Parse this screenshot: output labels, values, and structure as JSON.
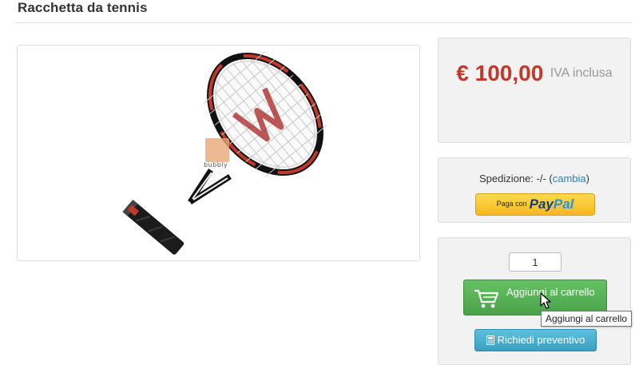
{
  "product": {
    "title": "Racchetta da tennis",
    "watermark": "bubbly"
  },
  "price": {
    "amount": "€ 100,00",
    "vat_note": "IVA inclusa"
  },
  "shipping": {
    "label": "Spedizione: -/- (",
    "change_link": "cambia",
    "close_paren": ")"
  },
  "paypal": {
    "prefix": "Paga con",
    "logo_pay": "Pay",
    "logo_pal": "Pal"
  },
  "cart": {
    "quantity": "1",
    "add_label": "Aggiungi al carrello",
    "quote_label": "Richiedi preventivo",
    "tooltip": "Aggiungi al carrello"
  },
  "colors": {
    "price": "#c0392b",
    "add_button": "#52a94f",
    "quote_button": "#46aed0",
    "link": "#2a80b9"
  },
  "icons": [
    "cart-icon",
    "calculator-icon",
    "pointer-cursor-icon"
  ]
}
